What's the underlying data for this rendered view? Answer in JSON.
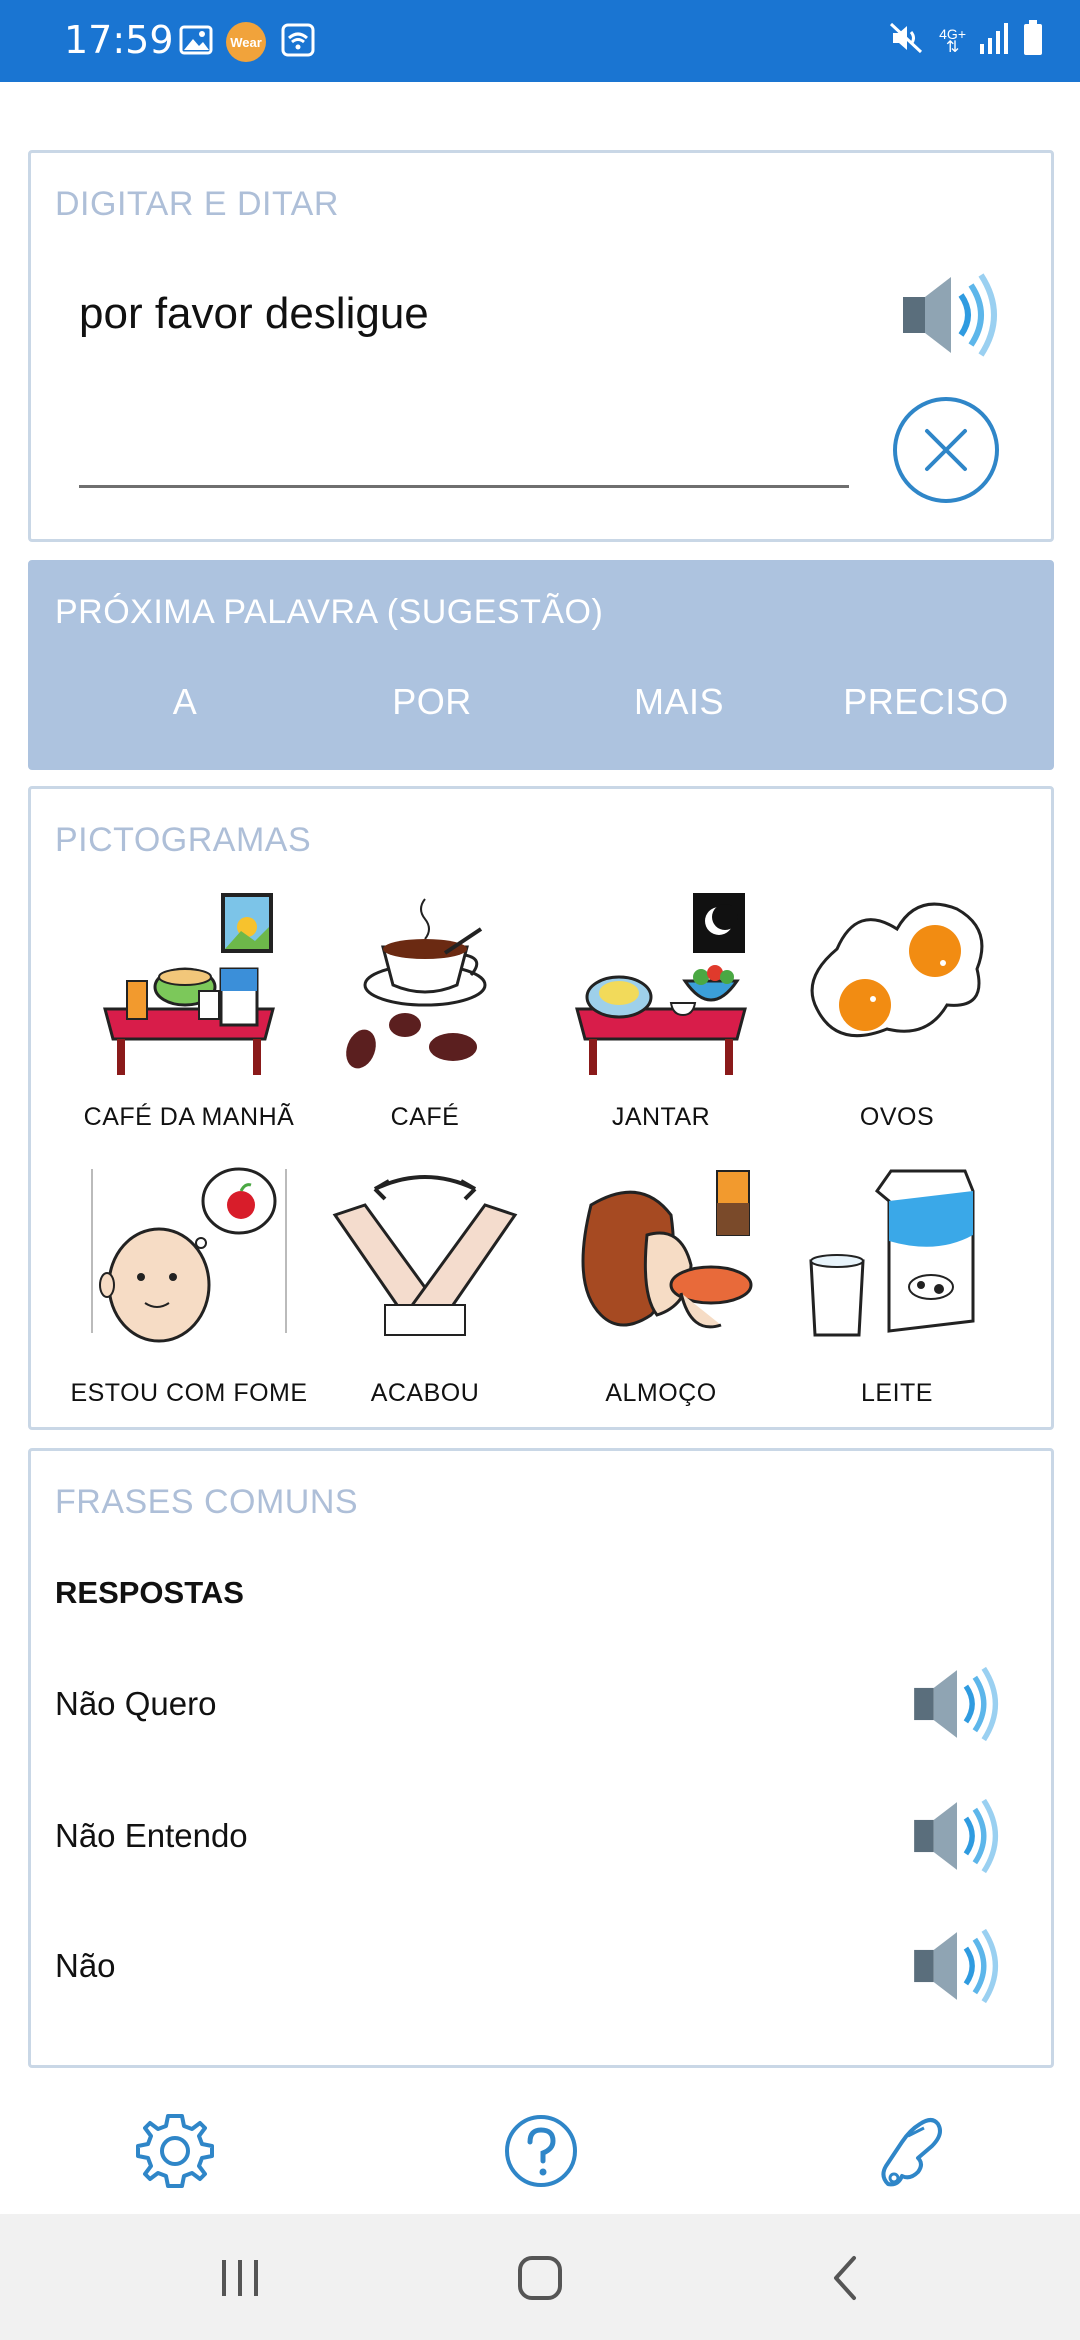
{
  "status_bar": {
    "time": "17:59",
    "wear_badge": "Wear",
    "icons": [
      "gallery-icon",
      "wear-icon",
      "wifi-calling-icon",
      "mute-icon",
      "network-4g-icon",
      "signal-icon",
      "battery-icon"
    ],
    "network_label": "4G+"
  },
  "typing": {
    "title": "DIGITAR E DITAR",
    "text": "por favor desligue"
  },
  "next_word": {
    "title": "PRÓXIMA PALAVRA (SUGESTÃO)",
    "suggestions": [
      "A",
      "POR",
      "MAIS",
      "PRECISO"
    ]
  },
  "pictograms": {
    "title": "PICTOGRAMAS",
    "items": [
      {
        "label": "CAFÉ DA MANHÃ",
        "icon": "breakfast-icon"
      },
      {
        "label": "CAFÉ",
        "icon": "coffee-icon"
      },
      {
        "label": "JANTAR",
        "icon": "dinner-icon"
      },
      {
        "label": "OVOS",
        "icon": "eggs-icon"
      },
      {
        "label": "ESTOU COM FOME",
        "icon": "hungry-icon"
      },
      {
        "label": "ACABOU",
        "icon": "finished-icon"
      },
      {
        "label": "ALMOÇO",
        "icon": "lunch-icon"
      },
      {
        "label": "LEITE",
        "icon": "milk-icon"
      }
    ]
  },
  "phrases": {
    "title": "FRASES COMUNS",
    "section": "RESPOSTAS",
    "items": [
      {
        "text": "Não Quero"
      },
      {
        "text": "Não Entendo"
      },
      {
        "text": "Não"
      }
    ]
  },
  "toolbar": {
    "icons": [
      "settings-icon",
      "help-icon",
      "hand-icon"
    ]
  },
  "colors": {
    "status_bar": "#1a75d2",
    "accent": "#2f86c8",
    "card_border": "#c9d7e6",
    "suggestion_panel": "#adc3df",
    "title_muted": "#aebfd8"
  }
}
